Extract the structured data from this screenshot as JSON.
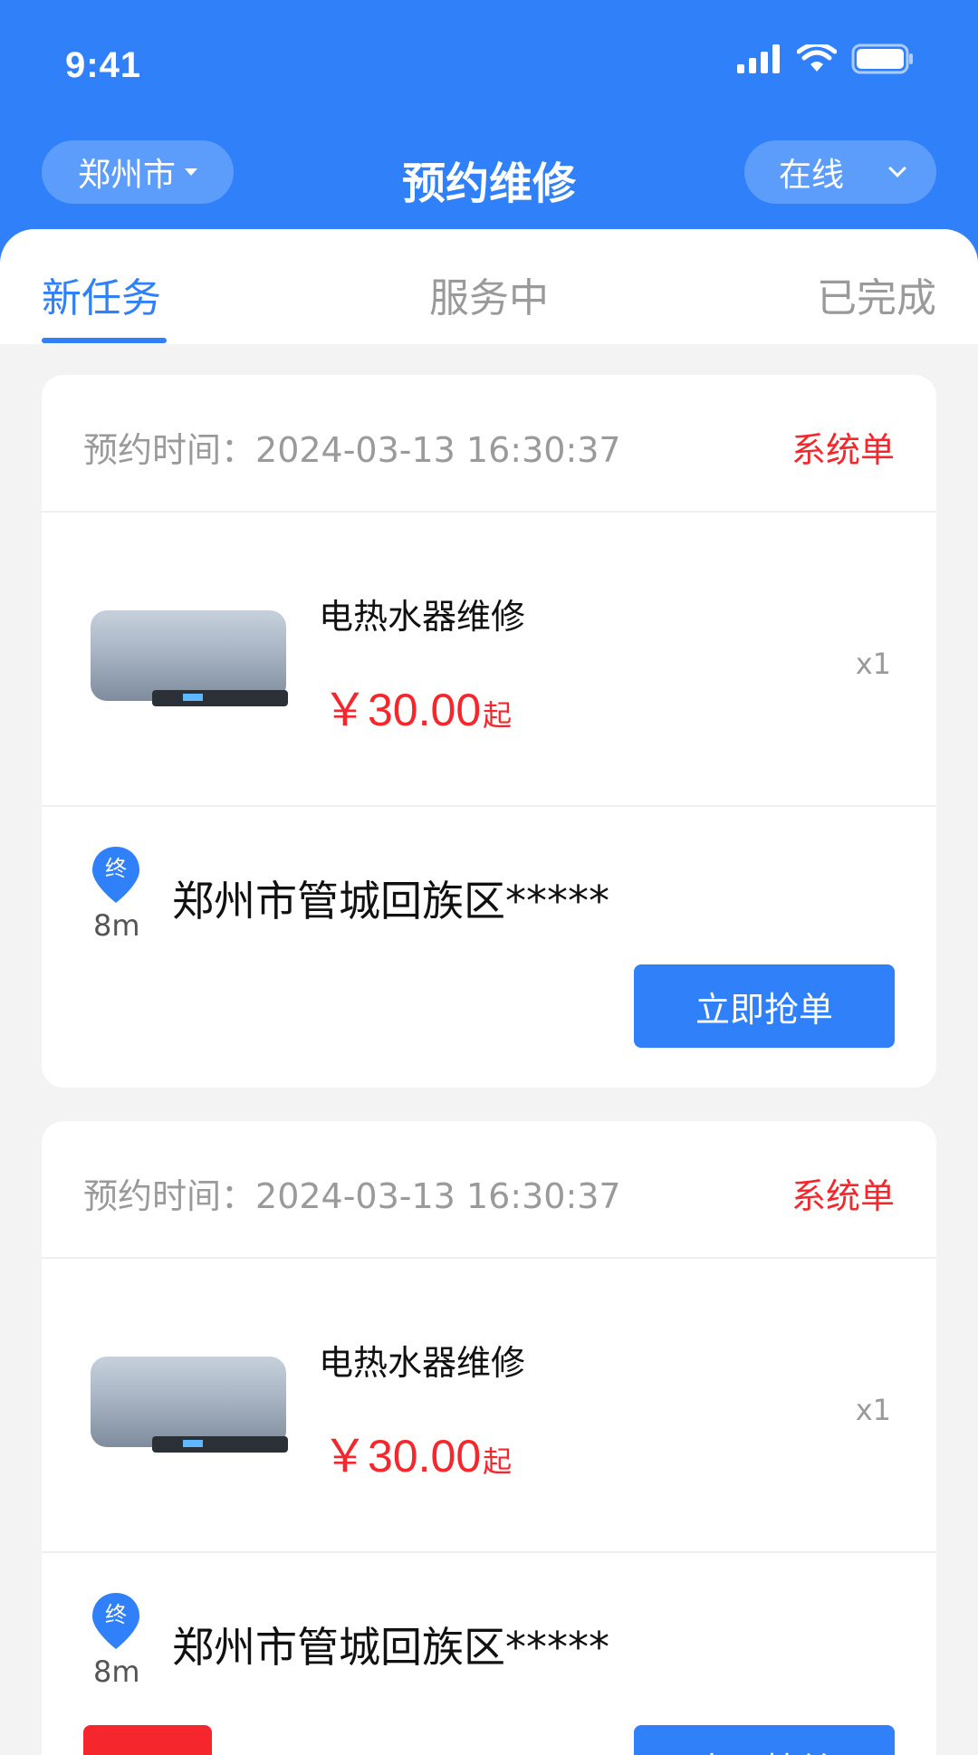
{
  "status_bar": {
    "time": "9:41"
  },
  "nav": {
    "city": "郑州市",
    "title": "预约维修",
    "online_status": "在线"
  },
  "tabs": [
    {
      "label": "新任务",
      "active": true
    },
    {
      "label": "服务中",
      "active": false
    },
    {
      "label": "已完成",
      "active": false
    }
  ],
  "orders": [
    {
      "appointment_label": "预约时间：",
      "appointment_time": "2024-03-13 16:30:37",
      "order_type": "系统单",
      "product_name": "电热水器维修",
      "price": "￥30.00",
      "price_suffix": "起",
      "quantity": "x1",
      "pin_label": "终",
      "distance": "8m",
      "address": "郑州市管城回族区*****",
      "action_label": "立即抢单"
    },
    {
      "appointment_label": "预约时间：",
      "appointment_time": "2024-03-13 16:30:37",
      "order_type": "系统单",
      "product_name": "电热水器维修",
      "price": "￥30.00",
      "price_suffix": "起",
      "quantity": "x1",
      "pin_label": "终",
      "distance": "8m",
      "address": "郑州市管城回族区*****",
      "action_label": "立即抢单"
    }
  ],
  "colors": {
    "primary": "#2f80f9",
    "accent_red": "#f5262c",
    "page_bg": "#f3f3f3"
  }
}
